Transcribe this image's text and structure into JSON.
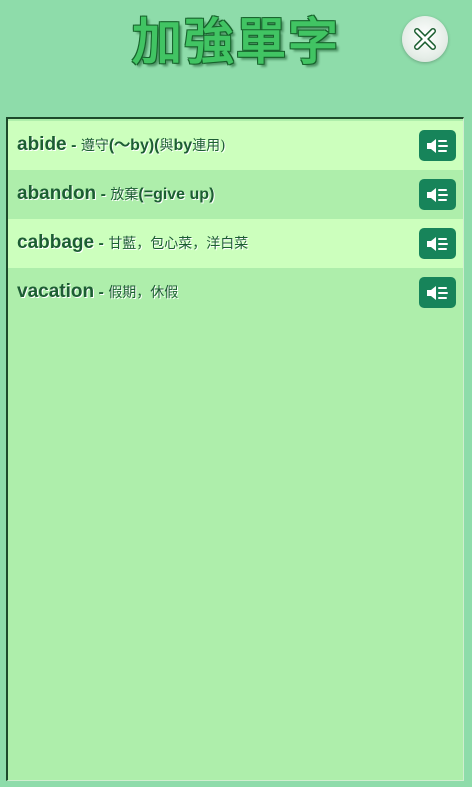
{
  "header": {
    "title": "加強單字",
    "close_icon": "close-x-icon"
  },
  "colors": {
    "background": "#8edcaa",
    "panel": "#aeeeab",
    "row_highlight": "#ccffbd",
    "text": "#1c5d33",
    "speak_button": "#17845a"
  },
  "words": [
    {
      "english": "abide",
      "separator": " - ",
      "chinese_before": "遵守",
      "chinese_bold": "(～by)(",
      "chinese_mid": "與",
      "chinese_bold2": "by",
      "chinese_after": "連用)",
      "icon": "speaker-icon"
    },
    {
      "english": "abandon",
      "separator": " - ",
      "chinese_before": "放棄",
      "chinese_bold": "(=give up)",
      "chinese_mid": "",
      "chinese_bold2": "",
      "chinese_after": "",
      "icon": "speaker-icon"
    },
    {
      "english": "cabbage",
      "separator": " - ",
      "chinese_before": "甘藍，包心菜，洋白菜",
      "chinese_bold": "",
      "chinese_mid": "",
      "chinese_bold2": "",
      "chinese_after": "",
      "icon": "speaker-icon"
    },
    {
      "english": "vacation",
      "separator": " - ",
      "chinese_before": "假期，休假",
      "chinese_bold": "",
      "chinese_mid": "",
      "chinese_bold2": "",
      "chinese_after": "",
      "icon": "speaker-icon"
    }
  ]
}
